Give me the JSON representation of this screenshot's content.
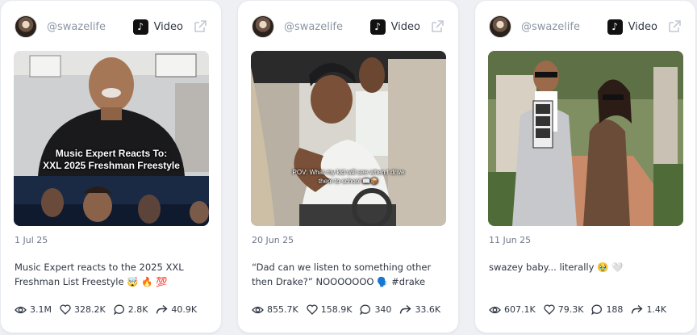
{
  "cards": [
    {
      "handle": "@swazelife",
      "type_label": "Video",
      "thumb_overlay_1": "Music Expert Reacts To:",
      "thumb_overlay_2": "XXL 2025 Freshman Freestyle",
      "date": "1 Jul 25",
      "caption": "Music Expert reacts to the 2025 XXL Freshman List Freestyle 🤯 🔥 💯",
      "stats": {
        "views": "3.1M",
        "likes": "328.2K",
        "comments": "2.8K",
        "shares": "40.9K"
      }
    },
    {
      "handle": "@swazelife",
      "type_label": "Video",
      "thumb_overlay_1": "POV: What my kid will see when I drive",
      "thumb_overlay_2": "them to school 📖📦",
      "date": "20 Jun 25",
      "caption": "“Dad can we listen to something other then Drake?” NOOOOOOO 🗣️ #drake",
      "stats": {
        "views": "855.7K",
        "likes": "158.9K",
        "comments": "340",
        "shares": "33.6K"
      }
    },
    {
      "handle": "@swazelife",
      "type_label": "Video",
      "date": "11 Jun 25",
      "caption": "swazey baby... literally 🥹 🤍",
      "stats": {
        "views": "607.1K",
        "likes": "79.3K",
        "comments": "188",
        "shares": "1.4K"
      }
    }
  ],
  "colors": {
    "card_bg": "#ffffff",
    "page_bg": "#eef0f4",
    "muted": "#8b95a3"
  },
  "icons": [
    "tiktok-icon",
    "external-link-icon",
    "eye-icon",
    "heart-icon",
    "comment-icon",
    "share-icon"
  ]
}
